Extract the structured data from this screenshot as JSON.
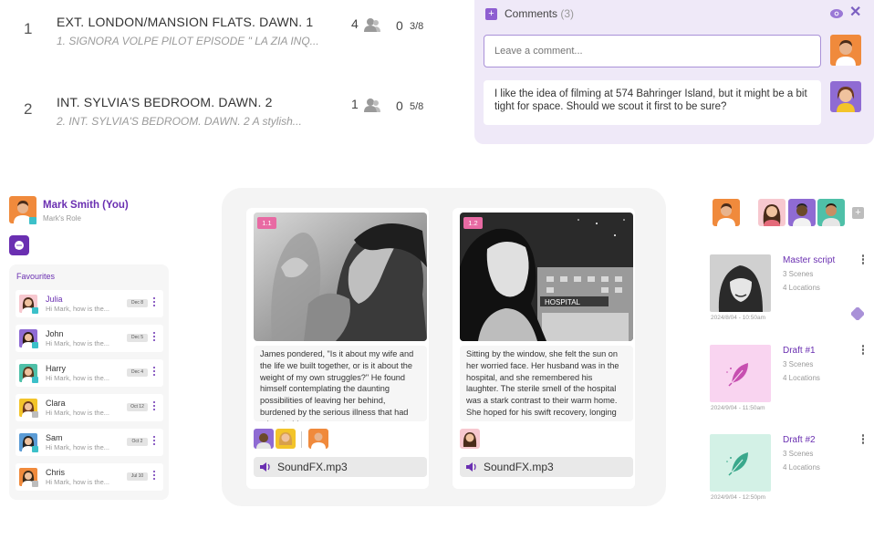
{
  "scenes": [
    {
      "number": "1",
      "title": "EXT. LONDON/MANSION FLATS. DAWN. 1",
      "subtitle": "1. SIGNORA VOLPE PILOT EPISODE \" LA ZIA INQ...",
      "people": "4",
      "zero": "0",
      "fraction": "3/8"
    },
    {
      "number": "2",
      "title": "INT. SYLVIA'S BEDROOM. DAWN. 2",
      "subtitle": "2. INT. SYLVIA'S BEDROOM. DAWN. 2 A stylish...",
      "people": "1",
      "zero": "0",
      "fraction": "5/8"
    }
  ],
  "comments": {
    "title": "Comments",
    "count": "(3)",
    "placeholder": "Leave a comment...",
    "items": [
      {
        "text": "I like the idea of filming at 574 Bahringer Island, but it might be a bit tight for space. Should we scout it first to be sure?"
      }
    ]
  },
  "profile": {
    "name": "Mark Smith (You)",
    "role": "Mark's Role"
  },
  "favourites": {
    "title": "Favourites",
    "items": [
      {
        "name": "Julia",
        "message": "Hi Mark, how is the...",
        "date": "Dec 8",
        "status": "#3cc0c9",
        "active": true
      },
      {
        "name": "John",
        "message": "Hi Mark, how is the...",
        "date": "Dec 5",
        "status": "#3cc0c9",
        "active": false
      },
      {
        "name": "Harry",
        "message": "Hi Mark, how is the...",
        "date": "Dec 4",
        "status": "#3cc0c9",
        "active": false
      },
      {
        "name": "Clara",
        "message": "Hi Mark, how is the...",
        "date": "Oct 12",
        "status": "#bdbdbd",
        "active": false
      },
      {
        "name": "Sam",
        "message": "Hi Mark, how is the...",
        "date": "Oct 2",
        "status": "#3cc0c9",
        "active": false
      },
      {
        "name": "Chris",
        "message": "Hi Mark, how is the...",
        "date": "Jul 10",
        "status": "#bdbdbd",
        "active": false
      }
    ]
  },
  "storyboard": {
    "cards": [
      {
        "badge": "1.1",
        "text": "James pondered, \"Is it about my wife and the life we built together, or is it about the weight of my own struggles?\" He found himself contemplating the daunting possibilities of leaving her behind, burdened by the serious illness that had taken hold ...",
        "audio": "SoundFX.mp3"
      },
      {
        "badge": "1.2",
        "text": "Sitting by the window, she felt the sun on her worried face. Her husband was in the hospital, and she remembered his laughter. The sterile smell of the hospital was a stark contrast to their warm home. She hoped for his swift recovery, longing t...",
        "audio": "SoundFX.mp3",
        "sign": "HOSPITAL"
      }
    ]
  },
  "scripts": [
    {
      "title": "Master script",
      "scenes": "3 Scenes",
      "locations": "4 Locations",
      "date": "2024/8/04 - 10:50am"
    },
    {
      "title": "Draft #1",
      "scenes": "3 Scenes",
      "locations": "4 Locations",
      "date": "2024/9/04 - 11:50am"
    },
    {
      "title": "Draft #2",
      "scenes": "3 Scenes",
      "locations": "4 Locations",
      "date": "2024/9/04 - 12:50pm"
    }
  ],
  "colors": {
    "accent": "#6a2fb1",
    "panel": "#efe9f8",
    "badge": "#e86aa3",
    "online": "#3cc0c9"
  },
  "icons": [
    "people-icon",
    "eye-icon",
    "close-icon",
    "chat-icon",
    "more-icon",
    "audio-icon",
    "feather-icon",
    "puzzle-icon",
    "plus-icon"
  ]
}
